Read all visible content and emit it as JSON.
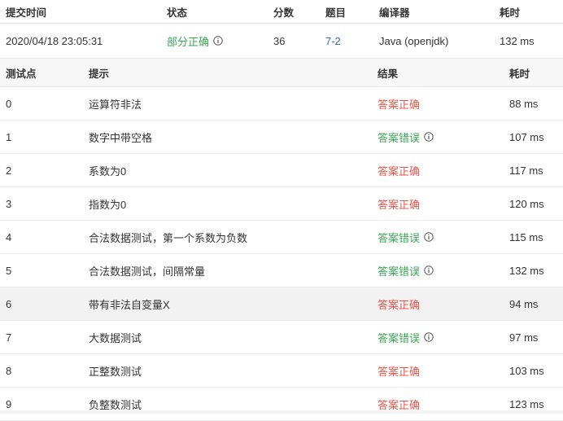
{
  "submission": {
    "headers": {
      "time": "提交时间",
      "status": "状态",
      "score": "分数",
      "problem": "题目",
      "compiler": "编译器",
      "cost": "耗时"
    },
    "row": {
      "time": "2020/04/18 23:05:31",
      "status": "部分正确",
      "score": "36",
      "problem": "7-2",
      "compiler": "Java (openjdk)",
      "cost": "132 ms"
    }
  },
  "tests": {
    "headers": {
      "id": "测试点",
      "hint": "提示",
      "result": "结果",
      "cost": "耗时"
    },
    "rows": [
      {
        "id": "0",
        "hint": "运算符非法",
        "result": "答案正确",
        "info": false,
        "cost": "88 ms"
      },
      {
        "id": "1",
        "hint": "数字中带空格",
        "result": "答案错误",
        "info": true,
        "cost": "107 ms"
      },
      {
        "id": "2",
        "hint": "系数为0",
        "result": "答案正确",
        "info": false,
        "cost": "117 ms"
      },
      {
        "id": "3",
        "hint": "指数为0",
        "result": "答案正确",
        "info": false,
        "cost": "120 ms"
      },
      {
        "id": "4",
        "hint": "合法数据测试，第一个系数为负数",
        "result": "答案错误",
        "info": true,
        "cost": "115 ms"
      },
      {
        "id": "5",
        "hint": "合法数据测试，间隔常量",
        "result": "答案错误",
        "info": true,
        "cost": "132 ms"
      },
      {
        "id": "6",
        "hint": "带有非法自变量X",
        "result": "答案正确",
        "info": false,
        "cost": "94 ms"
      },
      {
        "id": "7",
        "hint": "大数据测试",
        "result": "答案错误",
        "info": true,
        "cost": "97 ms"
      },
      {
        "id": "8",
        "hint": "正整数测试",
        "result": "答案正确",
        "info": false,
        "cost": "103 ms"
      },
      {
        "id": "9",
        "hint": "负整数测试",
        "result": "答案正确",
        "info": false,
        "cost": "123 ms"
      }
    ]
  },
  "colors": {
    "correct": "#e5554a",
    "wrong": "#3aa655",
    "partial": "#3aa655",
    "link": "#2f6fb0"
  },
  "icons": {
    "info": "info-circle-icon"
  }
}
